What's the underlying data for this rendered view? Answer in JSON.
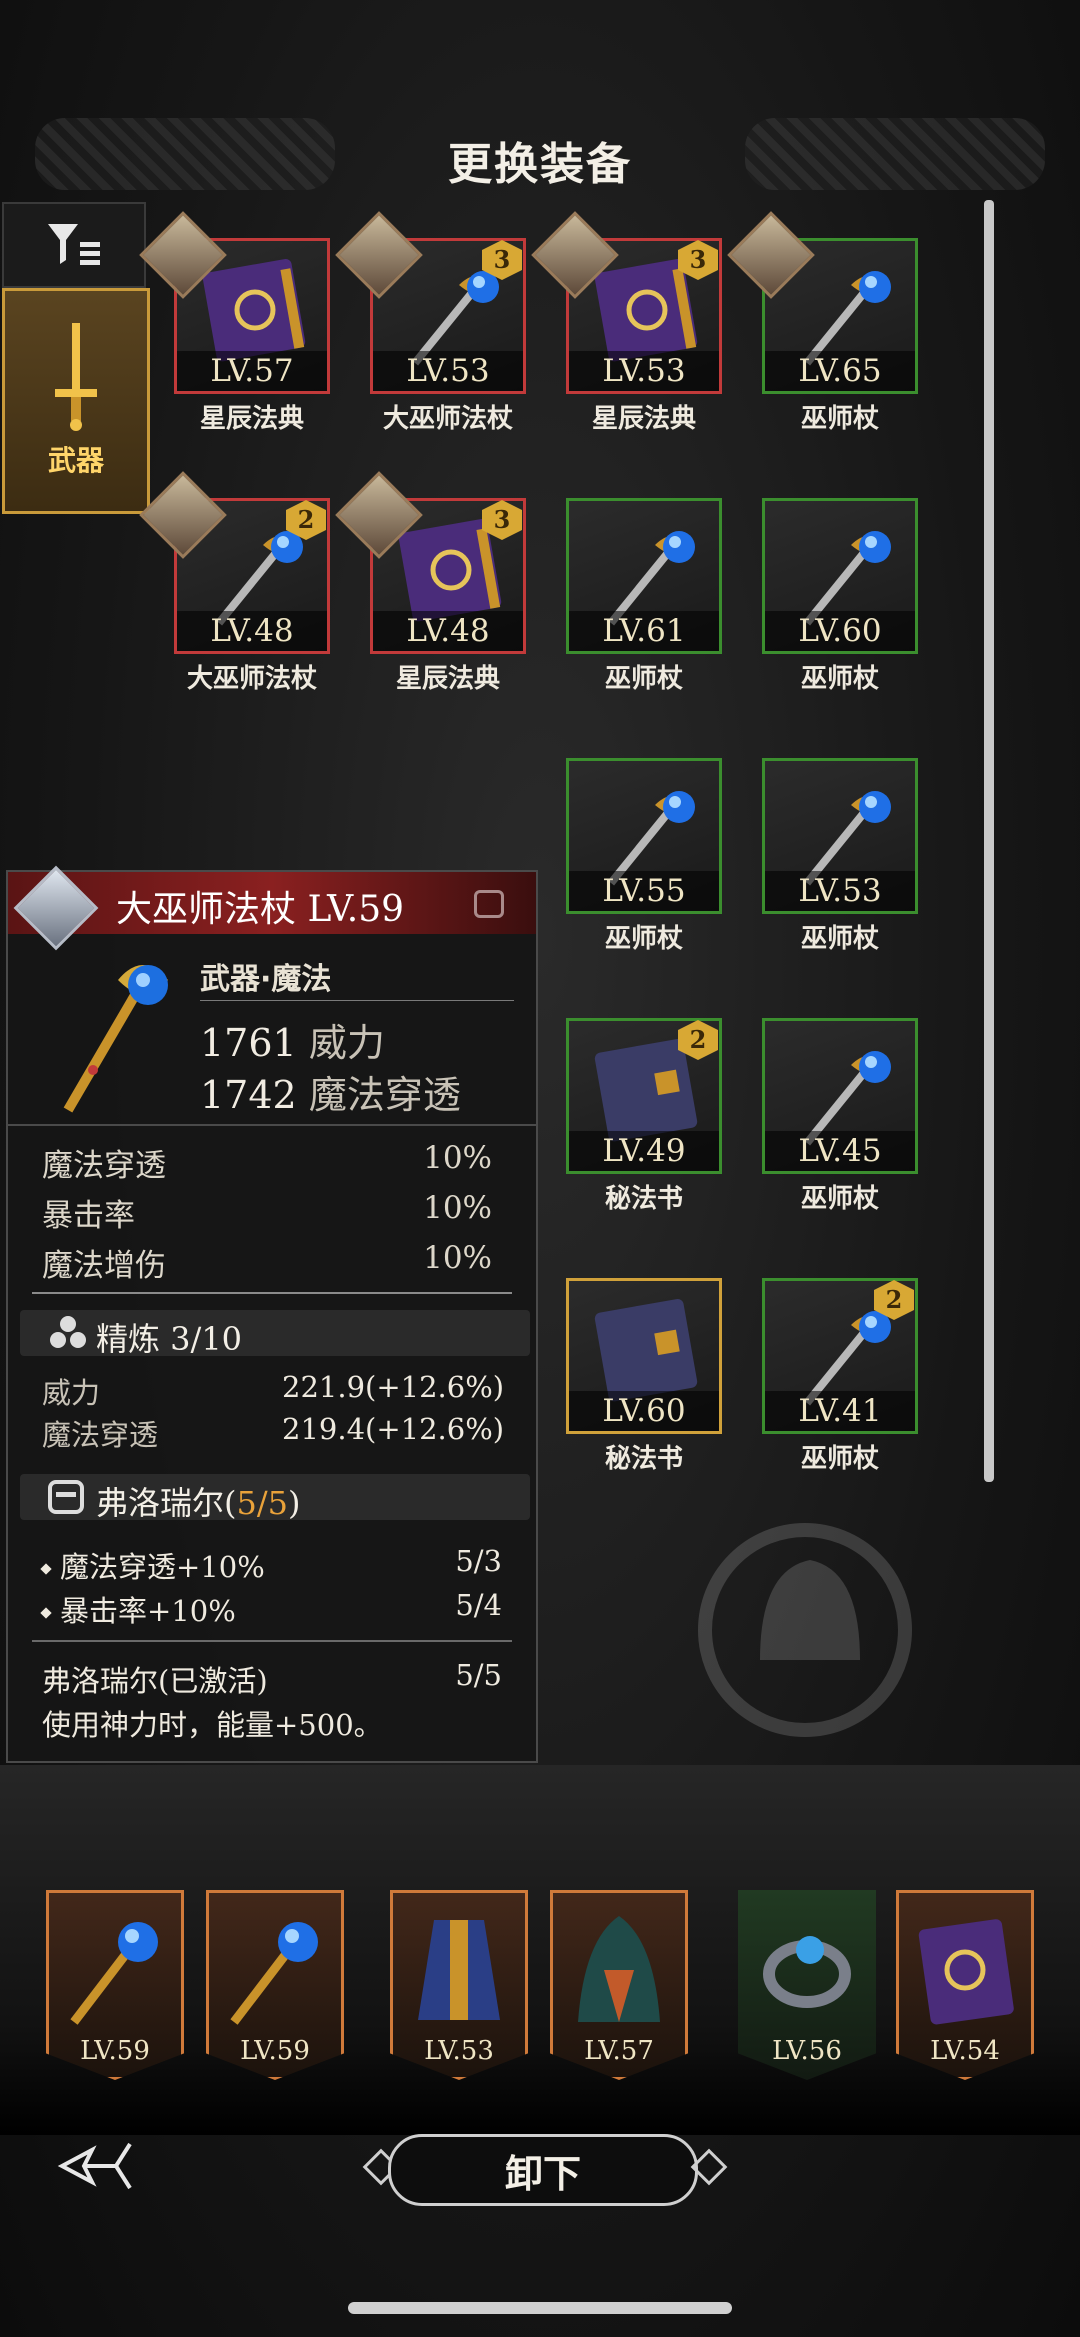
{
  "header": {
    "title": "更换装备"
  },
  "tabs": {
    "weapon_label": "武器"
  },
  "grid": [
    {
      "level": "LV.57",
      "name": "星辰法典",
      "icon": "book-icon",
      "border": "red",
      "refine": ""
    },
    {
      "level": "LV.53",
      "name": "大巫师法杖",
      "icon": "staff-icon",
      "border": "red",
      "refine": "3"
    },
    {
      "level": "LV.53",
      "name": "星辰法典",
      "icon": "book-icon",
      "border": "red",
      "refine": "3"
    },
    {
      "level": "LV.65",
      "name": "巫师杖",
      "icon": "staff-icon",
      "border": "green",
      "refine": ""
    },
    {
      "level": "LV.48",
      "name": "大巫师法杖",
      "icon": "staff-icon",
      "border": "red",
      "refine": "2"
    },
    {
      "level": "LV.48",
      "name": "星辰法典",
      "icon": "book-icon",
      "border": "red",
      "refine": "3"
    },
    {
      "level": "LV.61",
      "name": "巫师杖",
      "icon": "staff-icon",
      "border": "green",
      "refine": ""
    },
    {
      "level": "LV.60",
      "name": "巫师杖",
      "icon": "staff-icon",
      "border": "green",
      "refine": ""
    },
    {
      "level": "LV.55",
      "name": "巫师杖",
      "icon": "staff-icon",
      "border": "green",
      "refine": ""
    },
    {
      "level": "LV.53",
      "name": "巫师杖",
      "icon": "staff-icon",
      "border": "green",
      "refine": ""
    },
    {
      "level": "LV.49",
      "name": "秘法书",
      "icon": "tome-icon",
      "border": "green",
      "refine": "2"
    },
    {
      "level": "LV.45",
      "name": "巫师杖",
      "icon": "staff-icon",
      "border": "green",
      "refine": ""
    },
    {
      "level": "LV.60",
      "name": "秘法书",
      "icon": "tome-icon",
      "border": "gold",
      "refine": ""
    },
    {
      "level": "LV.41",
      "name": "巫师杖",
      "icon": "staff-icon",
      "border": "green",
      "refine": "2"
    }
  ],
  "detail": {
    "title": "大巫师法杖 LV.59",
    "type": "武器·魔法",
    "main_stats": [
      {
        "value": "1761",
        "label": "威力"
      },
      {
        "value": "1742",
        "label": "魔法穿透"
      }
    ],
    "sub_stats": [
      {
        "label": "魔法穿透",
        "value": "10%"
      },
      {
        "label": "暴击率",
        "value": "10%"
      },
      {
        "label": "魔法增伤",
        "value": "10%"
      }
    ],
    "refine_label": "精炼 3/10",
    "refine_stats": [
      {
        "label": "威力",
        "value": "221.9(+12.6%)"
      },
      {
        "label": "魔法穿透",
        "value": "219.4(+12.6%)"
      }
    ],
    "set_name": "弗洛瑞尔",
    "set_count": "5/5",
    "set_bonuses": [
      {
        "label": "魔法穿透+10%",
        "value": "5/3"
      },
      {
        "label": "暴击率+10%",
        "value": "5/4"
      }
    ],
    "set_active": {
      "label": "弗洛瑞尔(已激活)",
      "value": "5/5"
    },
    "set_desc": "使用神力时，能量+500。"
  },
  "equipped": [
    {
      "level": "LV.59",
      "icon": "staff-icon",
      "frame": "orange"
    },
    {
      "level": "LV.59",
      "icon": "staff-icon",
      "frame": "orange"
    },
    {
      "level": "LV.53",
      "icon": "robe-icon",
      "frame": "orange"
    },
    {
      "level": "LV.57",
      "icon": "cloak-icon",
      "frame": "orange"
    },
    {
      "level": "LV.56",
      "icon": "bracelet-icon",
      "frame": "green"
    },
    {
      "level": "LV.54",
      "icon": "book-icon",
      "frame": "orange"
    }
  ],
  "actions": {
    "unequip_label": "卸下"
  },
  "colors": {
    "red": "#c23a3a",
    "green": "#3b8e2e",
    "gold": "#d0a13a",
    "accent": "#ffd56a"
  }
}
